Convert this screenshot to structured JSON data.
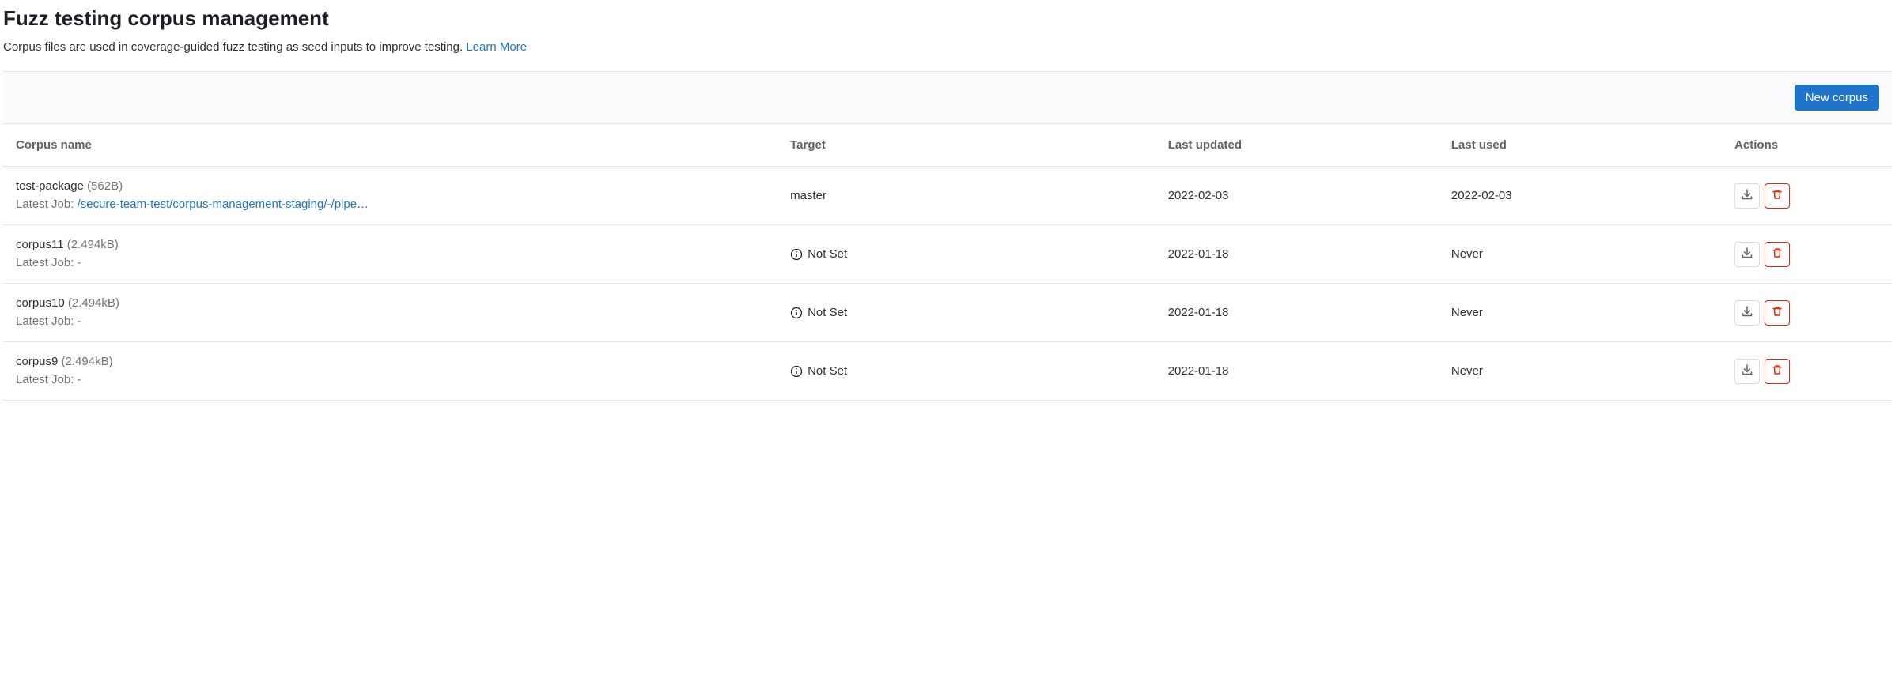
{
  "page": {
    "title": "Fuzz testing corpus management",
    "description": "Corpus files are used in coverage-guided fuzz testing as seed inputs to improve testing. ",
    "learn_more": "Learn More"
  },
  "toolbar": {
    "new_corpus": "New corpus"
  },
  "table": {
    "headers": {
      "name": "Corpus name",
      "target": "Target",
      "last_updated": "Last updated",
      "last_used": "Last used",
      "actions": "Actions"
    },
    "latest_job_label": "Latest Job: ",
    "not_set": "Not Set",
    "rows": [
      {
        "name": "test-package",
        "size": "(562B)",
        "latest_job_link": "/secure-team-test/corpus-management-staging/-/pipe…",
        "latest_job_text": "-",
        "has_job_link": true,
        "target": "master",
        "target_set": true,
        "last_updated": "2022-02-03",
        "last_used": "2022-02-03"
      },
      {
        "name": "corpus11",
        "size": "(2.494kB)",
        "latest_job_link": "",
        "latest_job_text": "-",
        "has_job_link": false,
        "target": "Not Set",
        "target_set": false,
        "last_updated": "2022-01-18",
        "last_used": "Never"
      },
      {
        "name": "corpus10",
        "size": "(2.494kB)",
        "latest_job_link": "",
        "latest_job_text": "-",
        "has_job_link": false,
        "target": "Not Set",
        "target_set": false,
        "last_updated": "2022-01-18",
        "last_used": "Never"
      },
      {
        "name": "corpus9",
        "size": "(2.494kB)",
        "latest_job_link": "",
        "latest_job_text": "-",
        "has_job_link": false,
        "target": "Not Set",
        "target_set": false,
        "last_updated": "2022-01-18",
        "last_used": "Never"
      }
    ]
  }
}
